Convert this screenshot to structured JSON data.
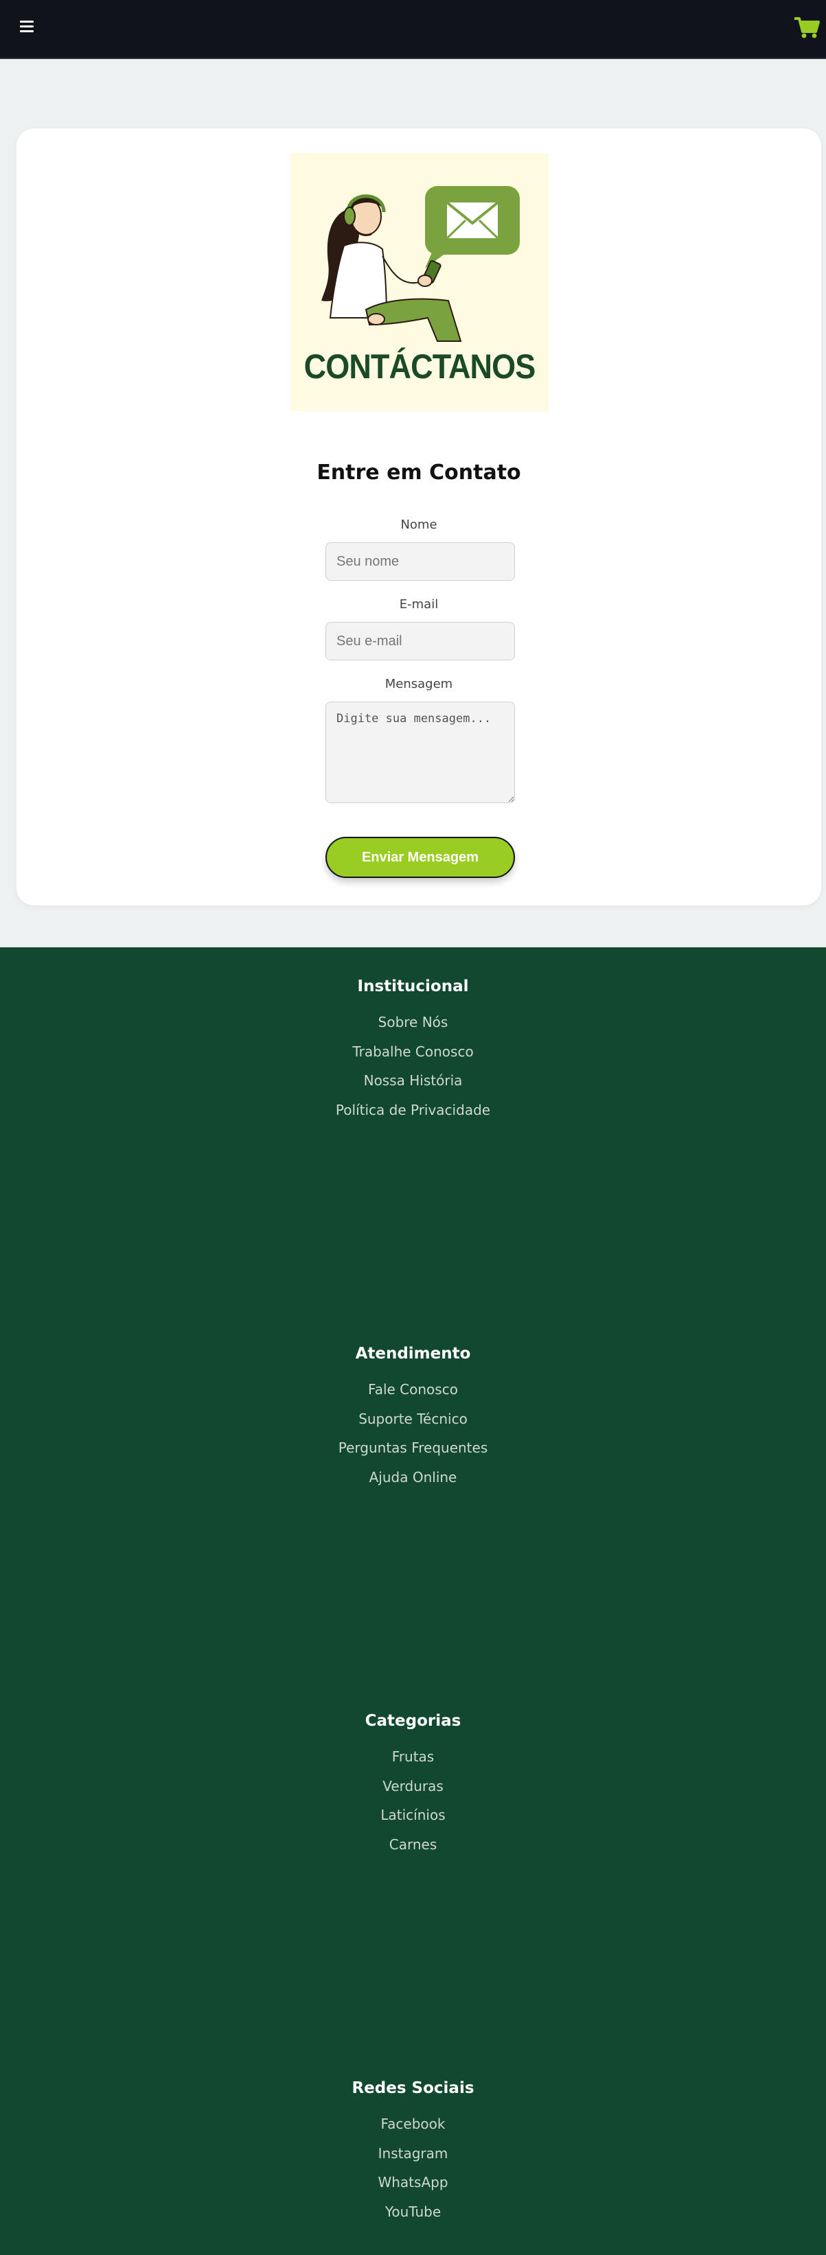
{
  "header": {
    "menu_icon": "hamburger-menu-icon",
    "cart_icon": "shopping-cart-icon",
    "accent_color": "#9acd22"
  },
  "illustration": {
    "text": "CONTÁCTANOS"
  },
  "form": {
    "title": "Entre em Contato",
    "name_label": "Nome",
    "name_placeholder": "Seu nome",
    "email_label": "E-mail",
    "email_placeholder": "Seu e-mail",
    "message_label": "Mensagem",
    "message_placeholder": "Digite sua mensagem...",
    "submit_label": "Enviar Mensagem"
  },
  "footer": {
    "sections": [
      {
        "title": "Institucional",
        "links": [
          "Sobre Nós",
          "Trabalhe Conosco",
          "Nossa História",
          "Política de Privacidade"
        ]
      },
      {
        "title": "Atendimento",
        "links": [
          "Fale Conosco",
          "Suporte Técnico",
          "Perguntas Frequentes",
          "Ajuda Online"
        ]
      },
      {
        "title": "Categorias",
        "links": [
          "Frutas",
          "Verduras",
          "Laticínios",
          "Carnes"
        ]
      },
      {
        "title": "Redes Sociais",
        "links": [
          "Facebook",
          "Instagram",
          "WhatsApp",
          "YouTube"
        ]
      }
    ]
  }
}
